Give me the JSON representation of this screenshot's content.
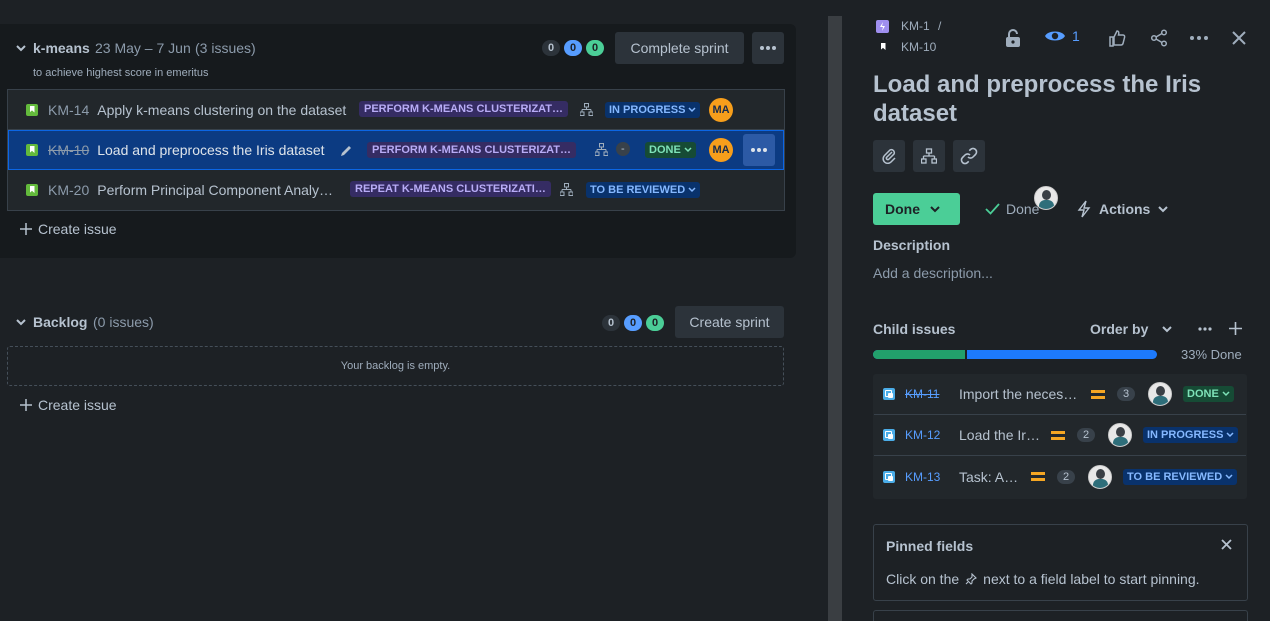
{
  "sprint": {
    "name": "k-means",
    "dates": "23 May – 7 Jun",
    "issue_count": "(3 issues)",
    "goal": "to achieve highest score in emeritus",
    "counts": [
      "0",
      "0",
      "0"
    ],
    "complete_label": "Complete sprint",
    "issues": [
      {
        "key": "KM-14",
        "summary": "Apply k-means clustering on the dataset",
        "epic": "PERFORM K-MEANS CLUSTERIZAT…",
        "status": "IN PROGRESS",
        "assignee": "MA"
      },
      {
        "key": "KM-10",
        "summary": "Load and preprocess the Iris dataset",
        "epic": "PERFORM K-MEANS CLUSTERIZAT…",
        "estimate": "-",
        "status": "DONE",
        "assignee": "MA"
      },
      {
        "key": "KM-20",
        "summary": "Perform Principal Component Analy…",
        "epic": "REPEAT K-MEANS CLUSTERIZATI…",
        "status": "TO BE REVIEWED"
      }
    ],
    "create_issue": "Create issue"
  },
  "backlog": {
    "name": "Backlog",
    "issue_count": "(0 issues)",
    "counts": [
      "0",
      "0",
      "0"
    ],
    "create_label": "Create sprint",
    "empty_text": "Your backlog is empty.",
    "create_issue": "Create issue"
  },
  "detail": {
    "parent_key": "KM-1",
    "separator": "/",
    "issue_key": "KM-10",
    "watch_count": "1",
    "title": "Load and preprocess the Iris dataset",
    "status_button": "Done",
    "resolution": "Done",
    "actions_label": "Actions",
    "description_heading": "Description",
    "description_placeholder": "Add a description...",
    "child_heading": "Child issues",
    "order_by": "Order by",
    "progress_text": "33% Done",
    "progress_done_fraction": 0.33,
    "children": [
      {
        "key": "KM-11",
        "summary": "Import the neces…",
        "estimate": "3",
        "status": "DONE"
      },
      {
        "key": "KM-12",
        "summary": "Load the Ir…",
        "estimate": "2",
        "status": "IN PROGRESS"
      },
      {
        "key": "KM-13",
        "summary": "Task: A…",
        "estimate": "2",
        "status": "TO BE REVIEWED"
      }
    ],
    "pinned_heading": "Pinned fields",
    "pinned_text_before": "Click on the",
    "pinned_text_after": "next to a field label to start pinning."
  }
}
